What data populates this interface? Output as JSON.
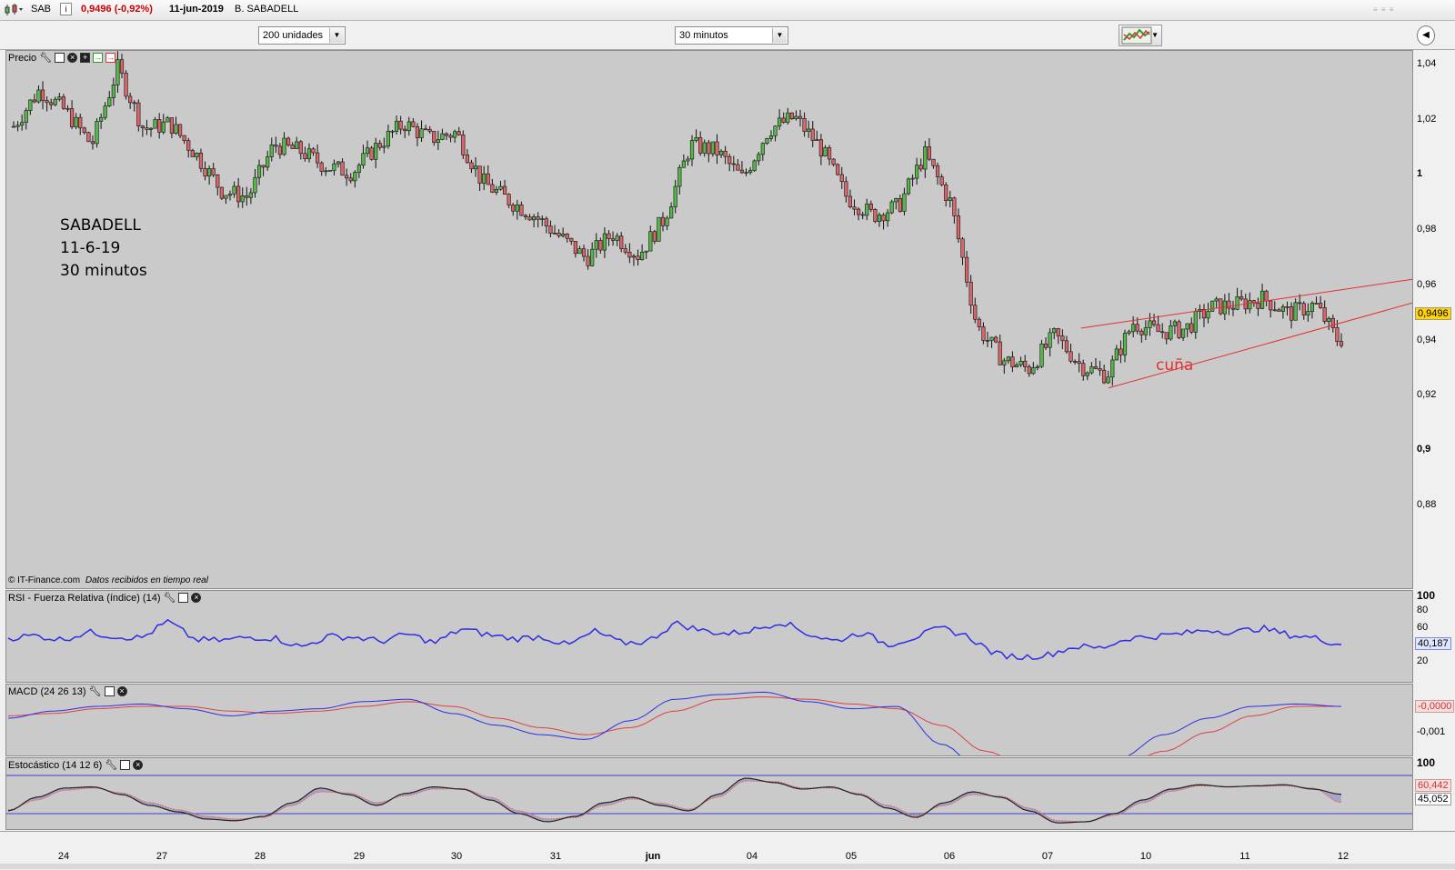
{
  "header": {
    "symbol": "SAB",
    "price_change": "0,9496 (-0,92%)",
    "date": "11-jun-2019",
    "name": "B. SABADELL"
  },
  "toolbar": {
    "units_select": "200 unidades",
    "interval_select": "30 minutos"
  },
  "price_panel": {
    "label": "Precio",
    "annotation_lines": [
      "SABADELL",
      "11-6-19",
      "30 minutos"
    ],
    "pattern_label": "cuña",
    "footer_source": "© IT-Finance.com",
    "footer_note": "Datos recibidos en tiempo real",
    "current_price_badge": "0,9496",
    "y_ticks": [
      "1,04",
      "1,02",
      "1",
      "0,98",
      "0,96",
      "0,94",
      "0,92",
      "0,9",
      "0,88"
    ]
  },
  "rsi_panel": {
    "label": "RSI - Fuerza Relativa (índice) (14)",
    "y_ticks": [
      "100",
      "80",
      "60",
      "40",
      "20"
    ],
    "value_badge": "40,187"
  },
  "macd_panel": {
    "label": "MACD (24 26 13)",
    "y_ticks": [
      "-0,001"
    ],
    "value_badge": "-0,0000"
  },
  "stoch_panel": {
    "label": "Estocástico (14 12 6)",
    "y_ticks": [
      "100"
    ],
    "value_badge_1": "60,442",
    "value_badge_2": "45,052"
  },
  "x_axis": {
    "labels": [
      "24",
      "27",
      "28",
      "29",
      "30",
      "31",
      "jun",
      "04",
      "05",
      "06",
      "07",
      "10",
      "11",
      "12"
    ]
  },
  "colors": {
    "panel_bg": "#cacaca",
    "bull": "#56b848",
    "bear": "#d9666a",
    "rsi": "#2d2de6",
    "macd_signal": "#e04040",
    "wedge": "#e53030",
    "badge_yellow": "#ffd400"
  },
  "chart_data": [
    {
      "type": "candlestick",
      "title": "Precio",
      "ylim": [
        0.87,
        1.045
      ],
      "x_labels": [
        "24",
        "27",
        "28",
        "29",
        "30",
        "31",
        "jun",
        "04",
        "05",
        "06",
        "07",
        "10",
        "11",
        "12"
      ],
      "close_path": [
        1.021,
        1.033,
        1.026,
        1.015,
        1.04,
        1.02,
        1.022,
        1.012,
        1.0,
        0.998,
        1.015,
        1.013,
        1.008,
        1.006,
        1.015,
        1.022,
        1.017,
        1.019,
        1.003,
        0.997,
        0.992,
        0.985,
        0.978,
        0.986,
        0.979,
        0.991,
        1.015,
        1.013,
        1.004,
        1.02,
        1.024,
        1.014,
        0.998,
        0.992,
        0.995,
        1.012,
        0.996,
        0.956,
        0.945,
        0.942,
        0.953,
        0.943,
        0.94,
        0.957,
        0.954,
        0.955,
        0.962,
        0.963,
        0.965,
        0.96,
        0.963,
        0.9496
      ],
      "last": 0.9496
    },
    {
      "type": "line",
      "title": "RSI - Fuerza Relativa (índice) (14)",
      "ylim": [
        0,
        100
      ],
      "series": [
        {
          "values": [
            48,
            51,
            46,
            55,
            50,
            48,
            68,
            46,
            45,
            49,
            48,
            37,
            50,
            49,
            44,
            53,
            42,
            59,
            52,
            47,
            50,
            39,
            56,
            42,
            44,
            66,
            57,
            53,
            58,
            68,
            53,
            44,
            55,
            40,
            49,
            60,
            50,
            29,
            25,
            28,
            38,
            36,
            48,
            50,
            53,
            58,
            55,
            60,
            52,
            48,
            40.187
          ]
        }
      ]
    },
    {
      "type": "line",
      "title": "MACD (24 26 13)",
      "series": [
        {
          "values": [
            -0.0005,
            -0.0002,
            0.0,
            0.0001,
            -0.0001,
            -0.0004,
            -0.0002,
            -0.0001,
            0.0002,
            0.0003,
            -0.0003,
            -0.0008,
            -0.0012,
            -0.0014,
            -0.0006,
            0.0003,
            0.0005,
            0.0006,
            0.0002,
            -0.0001,
            0.0,
            -0.0016,
            -0.0029,
            -0.0031,
            -0.0028,
            -0.0022,
            -0.0012,
            -0.0005,
            0.0,
            0.0001,
            -0.0
          ]
        },
        {
          "values": [
            -0.0004,
            -0.0003,
            -0.0001,
            0.0,
            0.0,
            -0.0002,
            -0.0003,
            -0.0002,
            0.0,
            0.0002,
            0.0,
            -0.0005,
            -0.0009,
            -0.0012,
            -0.0009,
            -0.0002,
            0.0003,
            0.0004,
            0.0003,
            0.0001,
            -0.0001,
            -0.0008,
            -0.0019,
            -0.0027,
            -0.0029,
            -0.0026,
            -0.0019,
            -0.0011,
            -0.0004,
            0.0,
            -0.0
          ]
        }
      ]
    },
    {
      "type": "line",
      "title": "Estocástico (14 12 6)",
      "ylim": [
        0,
        100
      ],
      "series": [
        {
          "values": [
            30,
            55,
            72,
            74,
            60,
            40,
            28,
            15,
            12,
            20,
            45,
            72,
            60,
            40,
            62,
            74,
            70,
            50,
            25,
            10,
            20,
            45,
            55,
            40,
            30,
            60,
            90,
            82,
            70,
            74,
            60,
            35,
            18,
            45,
            65,
            55,
            30,
            8,
            10,
            25,
            50,
            70,
            78,
            74,
            76,
            78,
            70,
            60.442
          ]
        },
        {
          "values": [
            32,
            50,
            68,
            72,
            63,
            45,
            32,
            20,
            15,
            18,
            40,
            65,
            63,
            45,
            58,
            70,
            71,
            55,
            30,
            15,
            18,
            40,
            52,
            44,
            33,
            55,
            85,
            84,
            72,
            72,
            62,
            40,
            22,
            40,
            60,
            57,
            35,
            12,
            10,
            22,
            45,
            66,
            76,
            75,
            75,
            76,
            72,
            45.052
          ]
        }
      ]
    }
  ]
}
